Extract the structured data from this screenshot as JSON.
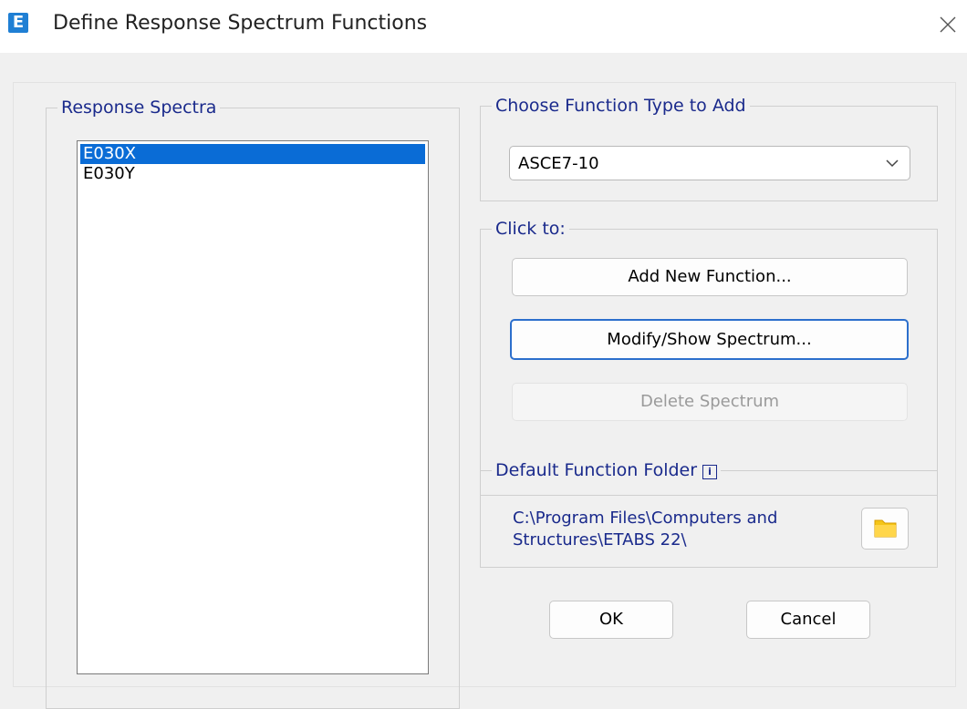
{
  "window": {
    "title": "Define Response Spectrum Functions",
    "app_icon_letter": "E",
    "icons": {
      "app": "etabs-app-icon",
      "close": "close-icon"
    }
  },
  "response_spectra": {
    "label": "Response Spectra",
    "items": [
      {
        "label": "E030X",
        "selected": true
      },
      {
        "label": "E030Y",
        "selected": false
      }
    ]
  },
  "choose_type": {
    "label": "Choose Function Type to Add",
    "selected": "ASCE7-10"
  },
  "click_to": {
    "label": "Click to:",
    "add_label": "Add New Function...",
    "modify_label": "Modify/Show Spectrum...",
    "delete_label": "Delete Spectrum",
    "delete_enabled": false
  },
  "default_folder": {
    "label": "Default Function Folder",
    "info_icon_text": "i",
    "path_line1": "C:\\Program Files\\Computers and",
    "path_line2": "Structures\\ETABS 22\\",
    "icons": {
      "folder": "folder-icon",
      "info": "info-icon"
    }
  },
  "footer": {
    "ok_label": "OK",
    "cancel_label": "Cancel"
  },
  "colors": {
    "selection": "#0a6cd6",
    "group_label": "#1a2a8c",
    "focus_border": "#2c6fcc",
    "app_icon": "#1f7fd4",
    "folder": "#f5c518"
  }
}
